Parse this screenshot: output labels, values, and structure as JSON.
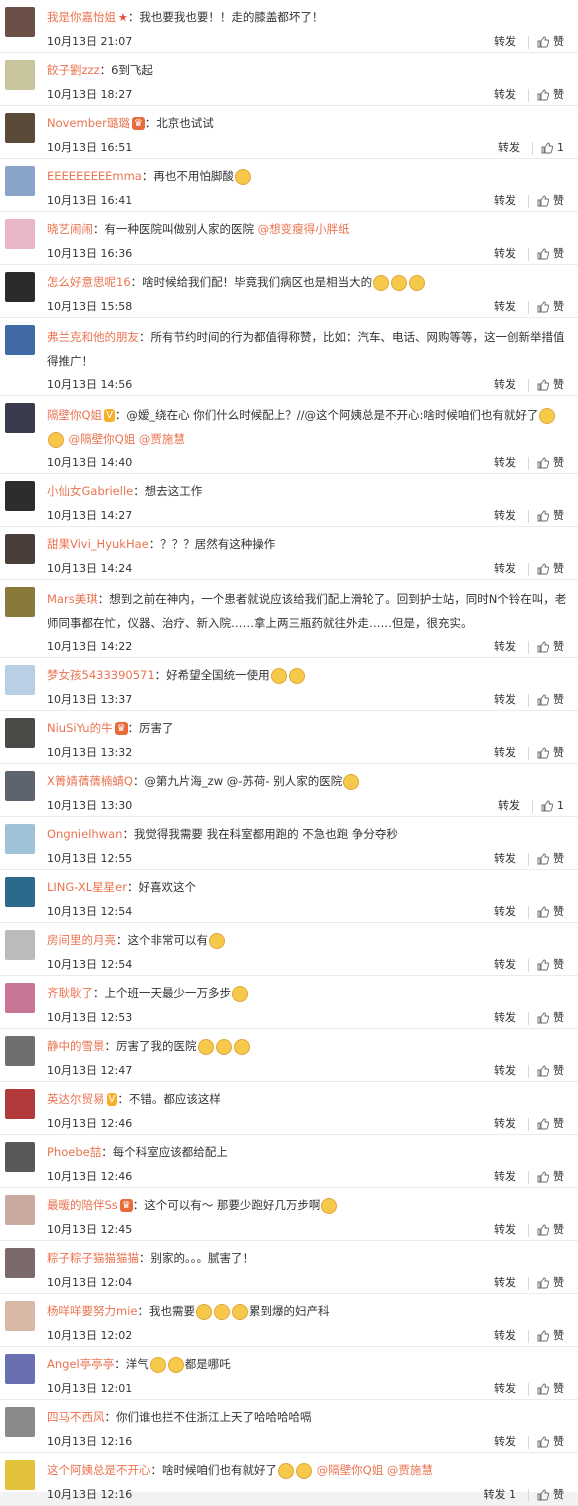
{
  "action_labels": {
    "repost": "转发",
    "like": "赞"
  },
  "comments": [
    {
      "user": "我是你嘉怡姐",
      "badge": "star",
      "text": "：我也要我也要！！走的膝盖都坏了！",
      "time": "10月13日 21:07",
      "repost": "转发",
      "like": "赞",
      "avatar_color": "#6b5048",
      "height": 53
    },
    {
      "user": "餃子劉zzz",
      "badge": "",
      "text": "：6到飞起",
      "time": "10月13日 18:27",
      "repost": "转发",
      "like": "赞",
      "avatar_color": "#c9c59c",
      "height": 53
    },
    {
      "user": "November璐璐",
      "badge": "crown",
      "text": "：北京也试试",
      "time": "10月13日 16:51",
      "repost": "转发",
      "like": "1",
      "avatar_color": "#5a4a3a",
      "height": 53
    },
    {
      "user": "EEEEEEEEEmma",
      "badge": "",
      "text": "：再也不用怕脚酸",
      "emoji_count": 1,
      "time": "10月13日 16:41",
      "repost": "转发",
      "like": "赞",
      "avatar_color": "#8aa4c9",
      "height": 53
    },
    {
      "user": "晓艺闹闹",
      "badge": "",
      "text": "：有一种医院叫做别人家的医院",
      "mention": "@想变瘦得小胖纸",
      "time": "10月13日 16:36",
      "repost": "转发",
      "like": "赞",
      "avatar_color": "#e9b7c6",
      "height": 53
    },
    {
      "user": "怎么好意思呢16",
      "badge": "",
      "text": "：啥时候给我们配！毕竟我们病区也是相当大的",
      "emoji_count": 3,
      "time": "10月13日 15:58",
      "repost": "转发",
      "like": "赞",
      "avatar_color": "#2b2b2b",
      "height": 53
    },
    {
      "user": "弗兰克和他的朋友",
      "badge": "",
      "text": "：所有节约时间的行为都值得称赞，比如：汽车、电话、网购等等，这一创新举措值得推广！",
      "time": "10月13日 14:56",
      "repost": "转发",
      "like": "赞",
      "avatar_color": "#3f6aa5",
      "height": 78,
      "wrap": true
    },
    {
      "user": "隔壁你Q姐",
      "badge": "vip",
      "text": "：@嫒_绕在心 你们什么时候配上？//@这个阿姨总是不开心:啥时候咱们也有就好了",
      "emoji_count": 2,
      "mention": "@隔壁你Q姐 @贾施慧",
      "time": "10月13日 14:40",
      "repost": "转发",
      "like": "赞",
      "avatar_color": "#3b3b4e",
      "height": 78,
      "wrap": true
    },
    {
      "user": "小仙女Gabrielle",
      "badge": "",
      "text": "：想去这工作",
      "time": "10月13日 14:27",
      "repost": "转发",
      "like": "赞",
      "avatar_color": "#2d2d2d",
      "height": 53
    },
    {
      "user": "甜果Vivi_HyukHae",
      "badge": "",
      "text": "：？？？居然有这种操作",
      "time": "10月13日 14:24",
      "repost": "转发",
      "like": "赞",
      "avatar_color": "#4a3e3a",
      "height": 53
    },
    {
      "user": "Mars美琪",
      "badge": "",
      "text": "：想到之前在神内，一个患者就说应该给我们配上滑轮了。回到护士站，同时N个铃在叫，老师同事都在忙，仪器、治疗、新入院……拿上两三瓶药就往外走……但是，很充实。",
      "time": "10月13日 14:22",
      "repost": "转发",
      "like": "赞",
      "avatar_color": "#8a7a3a",
      "height": 78,
      "wrap": true
    },
    {
      "user": "梦女孩5433390571",
      "badge": "",
      "text": "：好希望全国统一使用",
      "emoji_count": 2,
      "time": "10月13日 13:37",
      "repost": "转发",
      "like": "赞",
      "avatar_color": "#b8cfe6",
      "height": 53
    },
    {
      "user": "NiuSiYu的牛",
      "badge": "crown",
      "text": "：厉害了",
      "time": "10月13日 13:32",
      "repost": "转发",
      "like": "赞",
      "avatar_color": "#4a4a46",
      "height": 53
    },
    {
      "user": "X箐婧蒨蒨楠蜻Q",
      "badge": "",
      "text": "：@第九片海_zw @-苏荷- 别人家的医院",
      "emoji_count": 1,
      "time": "10月13日 13:30",
      "repost": "转发",
      "like": "1",
      "avatar_color": "#5d6470",
      "height": 53
    },
    {
      "user": "Ongnielhwan",
      "badge": "",
      "text": "：我觉得我需要 我在科室都用跑的 不急也跑 争分夺秒",
      "time": "10月13日 12:55",
      "repost": "转发",
      "like": "赞",
      "avatar_color": "#9fc2d9",
      "height": 53
    },
    {
      "user": "LING-XL星星er",
      "badge": "",
      "text": "：好喜欢这个",
      "time": "10月13日 12:54",
      "repost": "转发",
      "like": "赞",
      "avatar_color": "#2c6a8c",
      "height": 53
    },
    {
      "user": "房间里的月亮",
      "badge": "",
      "text": "：这个非常可以有",
      "emoji_count": 1,
      "time": "10月13日 12:54",
      "repost": "转发",
      "like": "赞",
      "avatar_color": "#bbbbbb",
      "height": 53
    },
    {
      "user": "齐耿耿了",
      "badge": "",
      "text": "：上个班一天最少一万多步",
      "emoji_count": 1,
      "time": "10月13日 12:53",
      "repost": "转发",
      "like": "赞",
      "avatar_color": "#c97595",
      "height": 53
    },
    {
      "user": "静中的雪景",
      "badge": "",
      "text": "：厉害了我的医院",
      "emoji_count": 3,
      "time": "10月13日 12:47",
      "repost": "转发",
      "like": "赞",
      "avatar_color": "#6f6f6f",
      "height": 53
    },
    {
      "user": "英达尔贸易",
      "badge": "vip",
      "text": "：不错。都应该这样",
      "time": "10月13日 12:46",
      "repost": "转发",
      "like": "赞",
      "avatar_color": "#b23a3a",
      "height": 53
    },
    {
      "user": "Phoebe喆",
      "badge": "",
      "text": "：每个科室应该都给配上",
      "time": "10月13日 12:46",
      "repost": "转发",
      "like": "赞",
      "avatar_color": "#595959",
      "height": 53
    },
    {
      "user": "最暖的陪伴Ss",
      "badge": "crown",
      "text": "：这个可以有～ 那要少跑好几万步啊",
      "emoji_count": 1,
      "time": "10月13日 12:45",
      "repost": "转发",
      "like": "赞",
      "avatar_color": "#caa9a0",
      "height": 53
    },
    {
      "user": "粽子粽子猫猫猫猫",
      "badge": "",
      "text": "：别家的。。。腻害了！",
      "time": "10月13日 12:04",
      "repost": "转发",
      "like": "赞",
      "avatar_color": "#7a6a6a",
      "height": 53
    },
    {
      "user": "杨咩咩要努力mie",
      "badge": "",
      "text": "：我也需要",
      "emoji_count": 3,
      "text2": "累到爆的妇产科",
      "time": "10月13日 12:02",
      "repost": "转发",
      "like": "赞",
      "avatar_color": "#d9b7a6",
      "height": 53
    },
    {
      "user": "Angel亭亭亭",
      "badge": "",
      "text": "：洋气",
      "emoji_count": 2,
      "text2": "都是哪吒",
      "time": "10月13日 12:01",
      "repost": "转发",
      "like": "赞",
      "avatar_color": "#6a6fb0",
      "height": 53
    },
    {
      "user": "四马不西风",
      "badge": "",
      "text": "：你们谁也拦不住浙江上天了哈哈哈哈嗝",
      "time": "10月13日 12:16",
      "repost": "转发",
      "like": "赞",
      "avatar_color": "#8a8a8a",
      "height": 53
    },
    {
      "user": "这个阿姨总是不开心",
      "badge": "",
      "text": "：啥时候咱们也有就好了",
      "emoji_count": 2,
      "mention": "@隔壁你Q姐 @贾施慧",
      "time": "10月13日 12:16",
      "repost": "转发 1",
      "like": "赞",
      "avatar_color": "#e2c23a",
      "height": 53
    }
  ]
}
